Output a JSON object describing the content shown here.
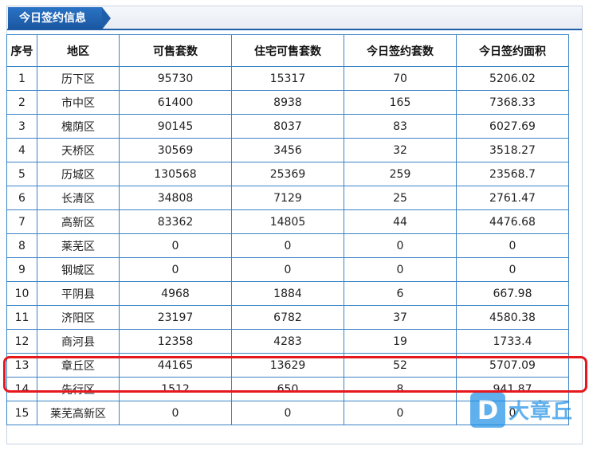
{
  "panel": {
    "title": "今日签约信息"
  },
  "table": {
    "headers": [
      "序号",
      "地区",
      "可售套数",
      "住宅可售套数",
      "今日签约套数",
      "今日签约面积"
    ],
    "rows": [
      [
        "1",
        "历下区",
        "95730",
        "15317",
        "70",
        "5206.02"
      ],
      [
        "2",
        "市中区",
        "61400",
        "8938",
        "165",
        "7368.33"
      ],
      [
        "3",
        "槐荫区",
        "90145",
        "8037",
        "83",
        "6027.69"
      ],
      [
        "4",
        "天桥区",
        "30569",
        "3456",
        "32",
        "3518.27"
      ],
      [
        "5",
        "历城区",
        "130568",
        "25369",
        "259",
        "23568.7"
      ],
      [
        "6",
        "长清区",
        "34808",
        "7129",
        "25",
        "2761.47"
      ],
      [
        "7",
        "高新区",
        "83362",
        "14805",
        "44",
        "4476.68"
      ],
      [
        "8",
        "莱芜区",
        "0",
        "0",
        "0",
        "0"
      ],
      [
        "9",
        "钢城区",
        "0",
        "0",
        "0",
        "0"
      ],
      [
        "10",
        "平阴县",
        "4968",
        "1884",
        "6",
        "667.98"
      ],
      [
        "11",
        "济阳区",
        "23197",
        "6782",
        "37",
        "4580.38"
      ],
      [
        "12",
        "商河县",
        "12358",
        "4283",
        "19",
        "1733.4"
      ],
      [
        "13",
        "章丘区",
        "44165",
        "13629",
        "52",
        "5707.09"
      ],
      [
        "14",
        "先行区",
        "1512",
        "650",
        "8",
        "941.87"
      ],
      [
        "15",
        "莱芜高新区",
        "0",
        "0",
        "0",
        "0"
      ]
    ],
    "highlighted_row": "13"
  },
  "watermark": {
    "logo_letter": "D",
    "text": "大章丘"
  },
  "colors": {
    "accent": "#1f5fa9",
    "grid": "#3a83c6",
    "highlight": "#e5181e"
  }
}
